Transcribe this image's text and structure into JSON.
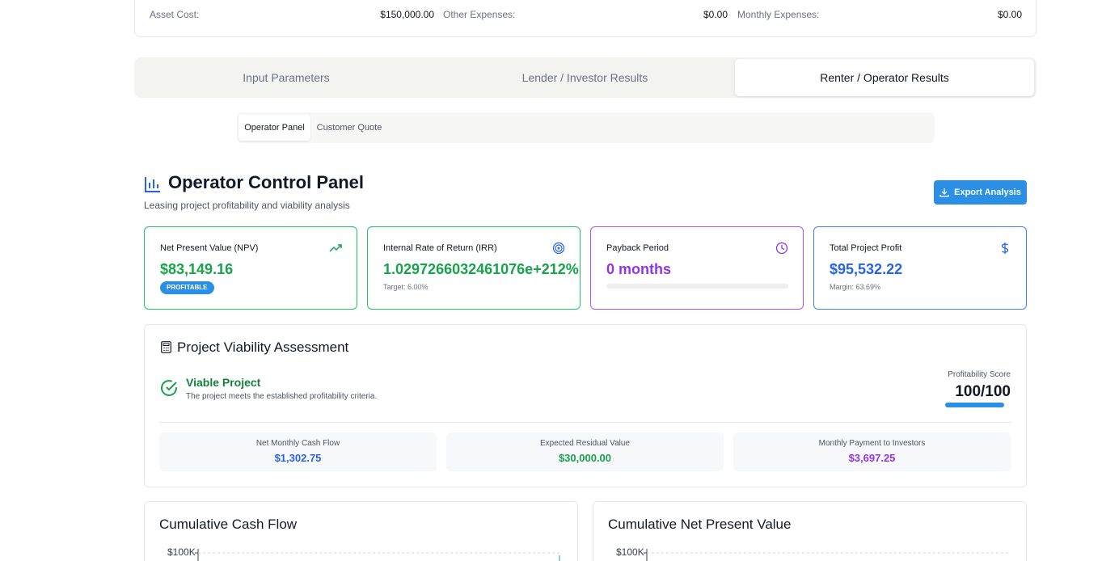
{
  "summary": [
    {
      "label": "Asset Cost:",
      "value": "$150,000.00"
    },
    {
      "label": "Other Expenses:",
      "value": "$0.00"
    },
    {
      "label": "Monthly Expenses:",
      "value": "$0.00"
    }
  ],
  "main_tabs": [
    "Input Parameters",
    "Lender / Investor Results",
    "Renter / Operator Results"
  ],
  "sub_tabs": [
    "Operator Panel",
    "Customer Quote"
  ],
  "header": {
    "title": "Operator Control Panel",
    "subtitle": "Leasing project profitability and viability analysis",
    "export_label": "Export Analysis"
  },
  "kpis": {
    "npv": {
      "title": "Net Present Value (NPV)",
      "value": "$83,149.16",
      "badge": "PROFITABLE",
      "color": "#16a34a"
    },
    "irr": {
      "title": "Internal Rate of Return (IRR)",
      "value": "1.0297266032461076e+212%",
      "note": "Target: 6.00%",
      "color": "#16a34a"
    },
    "payback": {
      "title": "Payback Period",
      "value": "0 months",
      "progress": 0,
      "color": "#9333ea"
    },
    "profit": {
      "title": "Total Project Profit",
      "value": "$95,532.22",
      "note": "Margin: 63.69%",
      "color": "#2563eb"
    }
  },
  "viability": {
    "title": "Project Viability Assessment",
    "status_title": "Viable Project",
    "status_desc": "The project meets the established profitability criteria.",
    "score_label": "Profitability Score",
    "score_value": "100/100",
    "score_fraction": 1.0,
    "metrics": [
      {
        "label": "Net Monthly Cash Flow",
        "value": "$1,302.75",
        "color": "#2563eb"
      },
      {
        "label": "Expected Residual Value",
        "value": "$30,000.00",
        "color": "#16a34a"
      },
      {
        "label": "Monthly Payment to Investors",
        "value": "$3,697.25",
        "color": "#9333ea"
      }
    ]
  },
  "charts": [
    {
      "title": "Cumulative Cash Flow",
      "top_tick": "$100K"
    },
    {
      "title": "Cumulative Net Present Value",
      "top_tick": "$100K"
    }
  ],
  "colors": {
    "accent": "#2b8fe6",
    "success": "#15803d",
    "purple": "#9333ea",
    "blue": "#2563eb"
  }
}
